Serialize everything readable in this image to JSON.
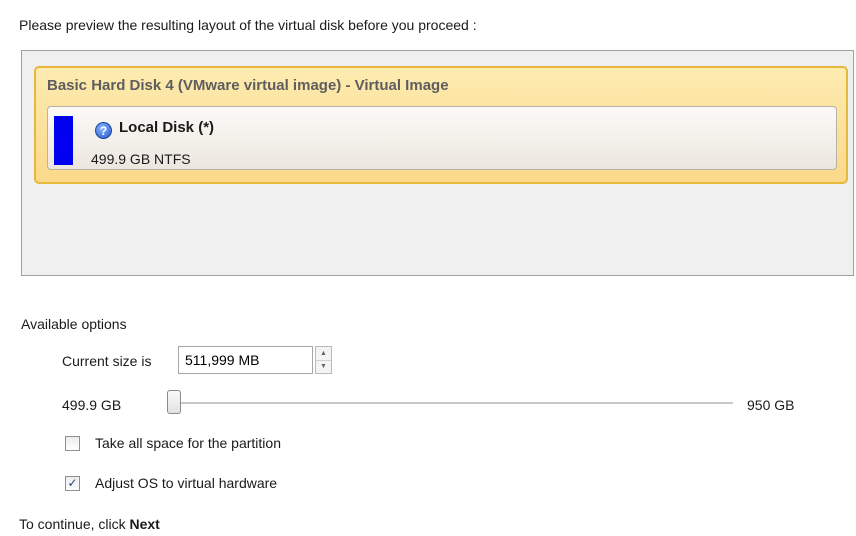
{
  "intro_text": "Please preview the resulting layout of the virtual disk before you proceed :",
  "disk": {
    "title": "Basic Hard Disk 4 (VMware virtual image) - Virtual Image",
    "partition": {
      "name": "Local Disk (*)",
      "info": "499.9 GB NTFS",
      "bar_color": "#0000ee"
    }
  },
  "options": {
    "label": "Available options",
    "current_size_label": "Current size is",
    "current_size_value": "511,999 MB",
    "slider": {
      "min_label": "499.9 GB",
      "max_label": "950 GB",
      "position_fraction": 0.0
    },
    "take_all_space": {
      "label": "Take all space for the partition",
      "checked": false
    },
    "adjust_os": {
      "label": "Adjust OS to virtual hardware",
      "checked": true,
      "check_glyph": "✓"
    }
  },
  "footer": {
    "prefix": "To continue, click ",
    "action": "Next"
  },
  "icons": {
    "help": "help-question-icon",
    "spin_up": "▲",
    "spin_down": "▼"
  }
}
